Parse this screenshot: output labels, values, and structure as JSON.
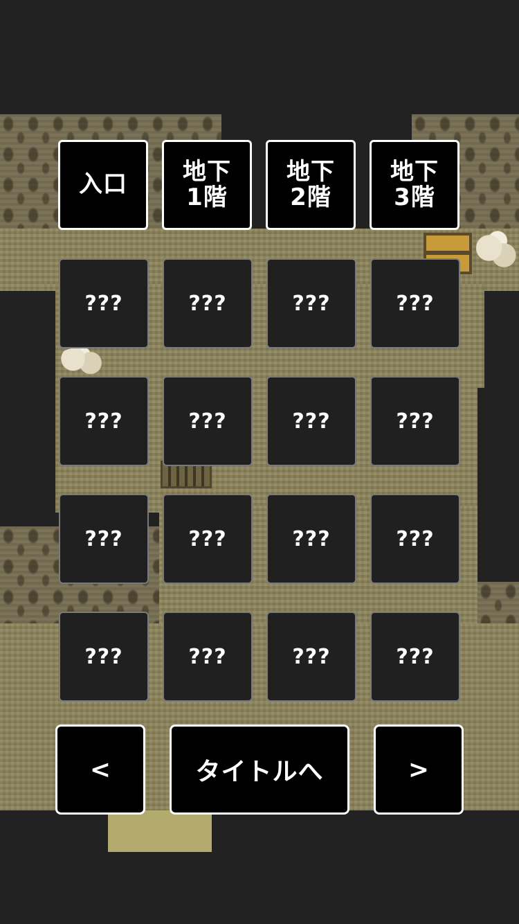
{
  "floors": [
    {
      "label": "入口"
    },
    {
      "label": "地下\n1階"
    },
    {
      "label": "地下\n2階"
    },
    {
      "label": "地下\n3階"
    }
  ],
  "locked_rows": [
    [
      "???",
      "???",
      "???",
      "???"
    ],
    [
      "???",
      "???",
      "???",
      "???"
    ],
    [
      "???",
      "???",
      "???",
      "???"
    ],
    [
      "???",
      "???",
      "???",
      "???"
    ]
  ],
  "nav": {
    "prev_label": "<",
    "title_label": "タイトルへ",
    "next_label": ">"
  },
  "colors": {
    "background": "#222222",
    "button_fill": "#000000",
    "button_border": "#ffffff",
    "locked_fill": "#202020",
    "locked_border": "#7a7a7a"
  }
}
